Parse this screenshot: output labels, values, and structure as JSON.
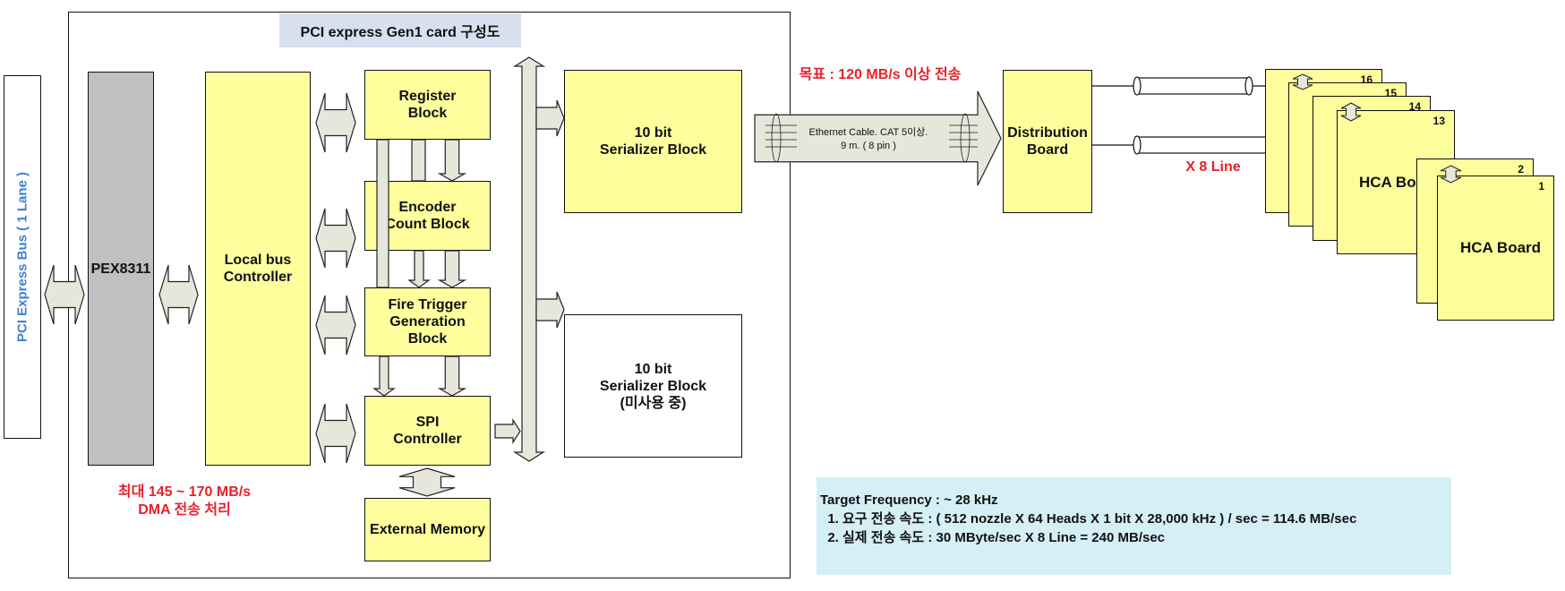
{
  "title": "PCI express Gen1 card 구성도",
  "bus_label": "PCI Express Bus ( 1 Lane )",
  "blocks": {
    "pex": "PEX8311",
    "local_bus": "Local bus\nController",
    "register": "Register\nBlock",
    "encoder": "Encoder\nCount Block",
    "fire_trigger": "Fire Trigger\nGeneration\nBlock",
    "spi": "SPI\nController",
    "external_memory": "External Memory",
    "serializer1": "10 bit\nSerializer Block",
    "serializer2": "10 bit\nSerializer Block\n(미사용 중)",
    "distribution": "Distribution\nBoard"
  },
  "annotations": {
    "dma": "최대 145 ~ 170 MB/s\nDMA 전송 처리",
    "target": "목표 : 120 MB/s 이상 전송",
    "cable": "Ethernet Cable. CAT 5이상.\n9 m. ( 8 pin )",
    "lines": "X 8 Line"
  },
  "hca_boards": [
    {
      "number": "16"
    },
    {
      "number": "15"
    },
    {
      "number": "14"
    },
    {
      "number": "13",
      "label": "HCA Boa"
    },
    {
      "number": "2"
    },
    {
      "number": "1",
      "label": "HCA Board"
    }
  ],
  "info": {
    "line1": "Target Frequency : ~ 28 kHz",
    "line2": "  1. 요구 전송 속도 : ( 512 nozzle X 64 Heads X 1 bit X 28,000 kHz ) / sec = 114.6 MB/sec",
    "line3": "  2. 실제 전송 속도 : 30 MByte/sec X 8 Line = 240 MB/sec"
  },
  "colors": {
    "block_fill": "#ffff9e",
    "pex_fill": "#c0c0c0",
    "title_fill": "#d6e0ee",
    "info_fill": "#d5eff6",
    "arrow_fill": "#e6e6da",
    "accent_red": "#e8202a",
    "bus_blue": "#3f7fcf"
  }
}
